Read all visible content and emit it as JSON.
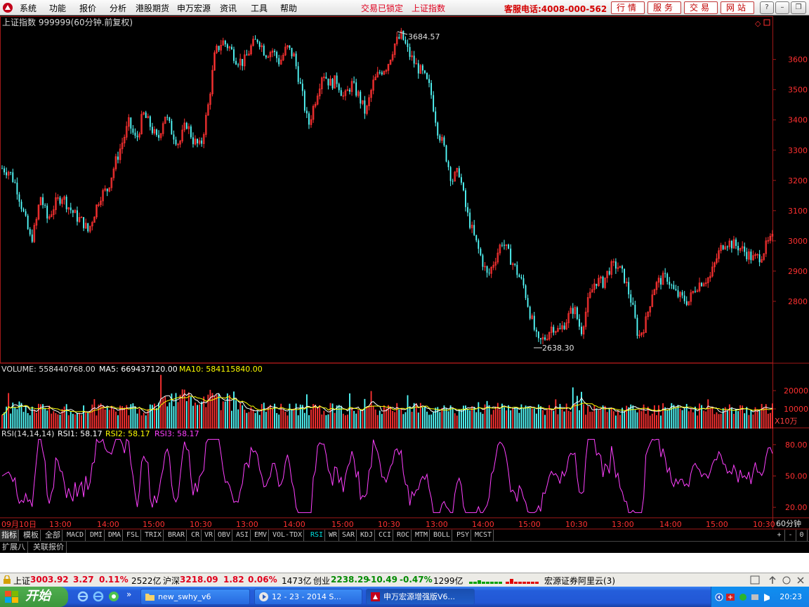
{
  "menubar": {
    "items": [
      "系统",
      "功能",
      "报价",
      "分析",
      "港股期货",
      "申万宏源",
      "资讯",
      "工具",
      "帮助"
    ],
    "alerts": [
      "交易已锁定",
      "上证指数"
    ],
    "hotline": "客服电话:4008-000-562",
    "buttons": [
      "行情",
      "服务",
      "交易",
      "网站"
    ]
  },
  "chart_header": {
    "title": "上证指数 999999(60分钟.前复权)"
  },
  "volume_header": {
    "label": "VOLUME: 558440768.00",
    "ma5": "MA5: 669437120.00",
    "ma10": "MA10: 584115840.00",
    "unit": "X10万"
  },
  "rsi_header": {
    "label": "RSI(14,14,14)",
    "rsi1": "RSI1: 58.17",
    "rsi2": "RSI2: 58.17",
    "rsi3": "RSI3: 58.17"
  },
  "annotations": {
    "high": "3684.57",
    "low": "2638.30"
  },
  "chart_data": {
    "type": "candlestick",
    "series": [
      {
        "name": "上证指数",
        "close_points": [
          [
            0,
            3240
          ],
          [
            3,
            3230
          ],
          [
            6,
            3180
          ],
          [
            9,
            3090
          ],
          [
            12,
            3000
          ],
          [
            14,
            3050
          ],
          [
            16,
            3150
          ],
          [
            19,
            3070
          ],
          [
            22,
            3120
          ],
          [
            25,
            3150
          ],
          [
            28,
            3110
          ],
          [
            31,
            3080
          ],
          [
            34,
            3060
          ],
          [
            36,
            3030
          ],
          [
            38,
            3080
          ],
          [
            41,
            3150
          ],
          [
            44,
            3170
          ],
          [
            47,
            3250
          ],
          [
            50,
            3320
          ],
          [
            53,
            3390
          ],
          [
            56,
            3330
          ],
          [
            59,
            3420
          ],
          [
            62,
            3380
          ],
          [
            65,
            3330
          ],
          [
            68,
            3420
          ],
          [
            71,
            3360
          ],
          [
            74,
            3320
          ],
          [
            77,
            3390
          ],
          [
            80,
            3330
          ],
          [
            83,
            3310
          ],
          [
            86,
            3440
          ],
          [
            89,
            3620
          ],
          [
            92,
            3660
          ],
          [
            95,
            3640
          ],
          [
            98,
            3600
          ],
          [
            101,
            3590
          ],
          [
            104,
            3640
          ],
          [
            107,
            3670
          ],
          [
            110,
            3620
          ],
          [
            113,
            3630
          ],
          [
            116,
            3590
          ],
          [
            119,
            3640
          ],
          [
            122,
            3610
          ],
          [
            125,
            3500
          ],
          [
            128,
            3380
          ],
          [
            131,
            3470
          ],
          [
            134,
            3560
          ],
          [
            137,
            3520
          ],
          [
            140,
            3530
          ],
          [
            143,
            3470
          ],
          [
            146,
            3520
          ],
          [
            149,
            3480
          ],
          [
            152,
            3420
          ],
          [
            155,
            3520
          ],
          [
            158,
            3560
          ],
          [
            161,
            3580
          ],
          [
            164,
            3650
          ],
          [
            167,
            3680
          ],
          [
            170,
            3620
          ],
          [
            173,
            3580
          ],
          [
            176,
            3550
          ],
          [
            179,
            3500
          ],
          [
            182,
            3370
          ],
          [
            185,
            3300
          ],
          [
            188,
            3200
          ],
          [
            191,
            3230
          ],
          [
            194,
            3100
          ],
          [
            197,
            3020
          ],
          [
            200,
            2950
          ],
          [
            203,
            2880
          ],
          [
            206,
            2940
          ],
          [
            209,
            3000
          ],
          [
            212,
            2950
          ],
          [
            215,
            2900
          ],
          [
            218,
            2850
          ],
          [
            221,
            2750
          ],
          [
            224,
            2660
          ],
          [
            227,
            2680
          ],
          [
            230,
            2720
          ],
          [
            233,
            2700
          ],
          [
            236,
            2740
          ],
          [
            239,
            2780
          ],
          [
            242,
            2700
          ],
          [
            245,
            2800
          ],
          [
            248,
            2870
          ],
          [
            251,
            2860
          ],
          [
            254,
            2910
          ],
          [
            257,
            2920
          ],
          [
            260,
            2880
          ],
          [
            263,
            2800
          ],
          [
            266,
            2680
          ],
          [
            269,
            2730
          ],
          [
            272,
            2840
          ],
          [
            275,
            2870
          ],
          [
            278,
            2880
          ],
          [
            281,
            2830
          ],
          [
            284,
            2810
          ],
          [
            287,
            2800
          ],
          [
            290,
            2850
          ],
          [
            293,
            2870
          ],
          [
            296,
            2880
          ],
          [
            299,
            2950
          ],
          [
            302,
            3000
          ],
          [
            305,
            2990
          ],
          [
            308,
            2980
          ],
          [
            311,
            2960
          ],
          [
            314,
            2940
          ],
          [
            317,
            2950
          ],
          [
            320,
            2990
          ],
          [
            322,
            3005
          ]
        ]
      }
    ],
    "y_ticks": [
      "3600",
      "3500",
      "3400",
      "3300",
      "3200",
      "3100",
      "3000",
      "2900",
      "2800"
    ],
    "y_range": [
      2600,
      3720
    ],
    "volume_ticks": [
      "20000",
      "10000"
    ],
    "rsi_ticks": [
      "80.00",
      "50.00",
      "20.00"
    ],
    "x_ticks": [
      "09月10日",
      "13:00",
      "14:00",
      "15:00",
      "10:30",
      "13:00",
      "14:00",
      "15:00",
      "10:30",
      "13:00",
      "14:00",
      "15:00",
      "10:30",
      "13:00",
      "14:00",
      "15:00",
      "10:30"
    ],
    "period": "60分钟"
  },
  "indicator_tabs": [
    "指标",
    "模板",
    "全部",
    "MACD",
    "DMI",
    "DMA",
    "FSL",
    "TRIX",
    "BRAR",
    "CR",
    "VR",
    "OBV",
    "ASI",
    "EMV",
    "VOL-TDX",
    "RSI",
    "WR",
    "SAR",
    "KDJ",
    "CCI",
    "ROC",
    "MTM",
    "BOLL",
    "PSY",
    "MCST"
  ],
  "zoom_controls": [
    "+",
    "-",
    "0"
  ],
  "ext_tabs": [
    "扩展八",
    "关联报价"
  ],
  "statusbar": {
    "sh_name": "上证",
    "sh_val": "3003.92",
    "sh_chg": "3.27",
    "sh_pct": "0.11%",
    "sh_amt": "2522亿",
    "hs_name": "沪深",
    "hs_val": "3218.09",
    "hs_chg": "1.82",
    "hs_pct": "0.06%",
    "hs_amt": "1473亿",
    "cy_name": "创业",
    "cy_val": "2238.29",
    "cy_chg": "-10.49",
    "cy_pct": "-0.47%",
    "cy_amt": "1299亿",
    "server": "宏源证券阿里云(3)"
  },
  "taskbar": {
    "start": "开始",
    "items": [
      "new_swhy_v6",
      "12 - 23 - 2014 S...",
      "申万宏源增强版V6..."
    ],
    "clock": "20:23"
  },
  "colors": {
    "up": "#ff3232",
    "down": "#54ffff",
    "rsi": "#ff40ff",
    "ma5": "#ffffff",
    "ma10": "#ffff00"
  }
}
